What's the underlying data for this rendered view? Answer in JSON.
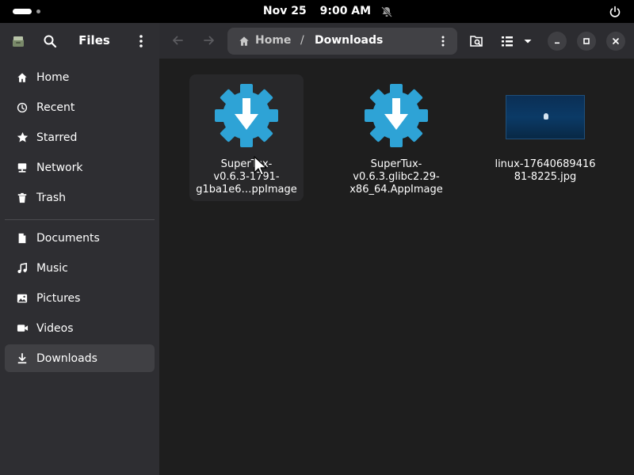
{
  "topbar": {
    "date": "Nov 25",
    "time": "9:00 AM"
  },
  "sidebar": {
    "title": "Files",
    "items": [
      {
        "label": "Home",
        "icon": "home-icon"
      },
      {
        "label": "Recent",
        "icon": "clock-icon"
      },
      {
        "label": "Starred",
        "icon": "star-icon"
      },
      {
        "label": "Network",
        "icon": "network-icon"
      },
      {
        "label": "Trash",
        "icon": "trash-icon"
      },
      {
        "label": "Documents",
        "icon": "document-icon"
      },
      {
        "label": "Music",
        "icon": "music-icon"
      },
      {
        "label": "Pictures",
        "icon": "picture-icon"
      },
      {
        "label": "Videos",
        "icon": "video-icon"
      },
      {
        "label": "Downloads",
        "icon": "download-icon",
        "active": true
      }
    ]
  },
  "pathbar": {
    "home": "Home",
    "separator": "/",
    "current": "Downloads"
  },
  "files": [
    {
      "name": "SuperTux-\nv0.6.3-1791-\ng1ba1e6…ppImage",
      "type": "appimage",
      "selected": true
    },
    {
      "name": "SuperTux-\nv0.6.3.glibc2.29-\nx86_64.AppImage",
      "type": "appimage",
      "selected": false
    },
    {
      "name": "linux-17640689416\n81-8225.jpg",
      "type": "image",
      "selected": false
    }
  ],
  "colors": {
    "accent": "#2ea3d6",
    "sidebar_bg": "#2e2e32",
    "content_bg": "#1e1e1e"
  }
}
